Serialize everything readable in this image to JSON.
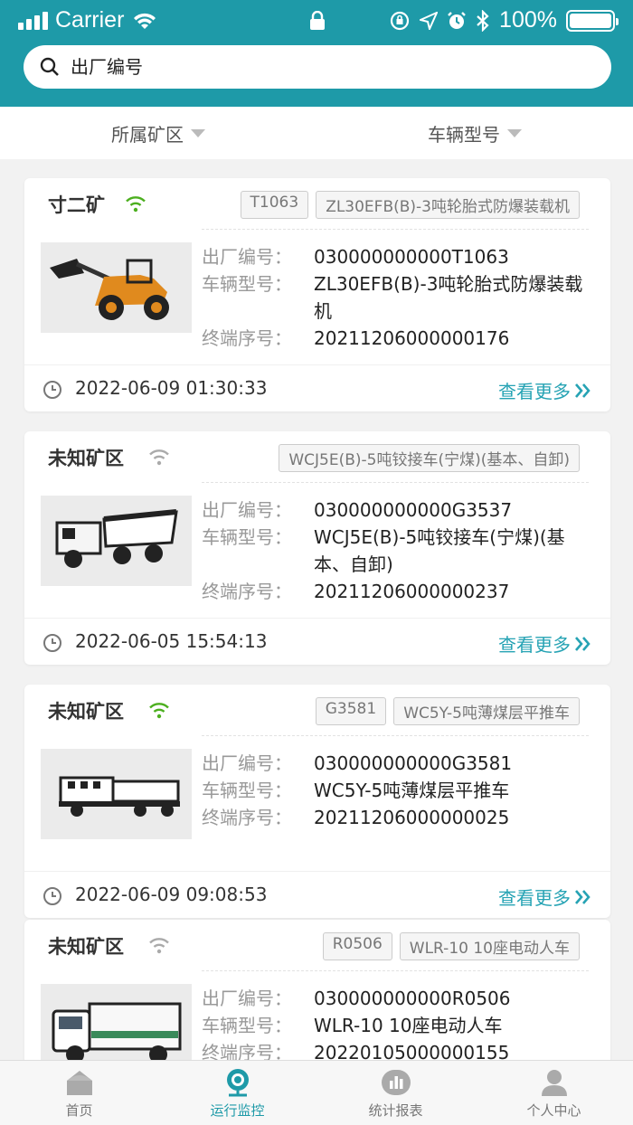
{
  "status_bar": {
    "carrier": "Carrier",
    "battery": "100%"
  },
  "search": {
    "placeholder": "出厂编号"
  },
  "filters": [
    {
      "label": "所属矿区"
    },
    {
      "label": "车辆型号"
    }
  ],
  "labels": {
    "factory_no": "出厂编号：",
    "model": "车辆型号：",
    "terminal": "终端序号：",
    "more": "查看更多"
  },
  "colors": {
    "primary": "#1e9aa8",
    "online": "#4caf1f",
    "offline": "#aaaaaa",
    "link": "#26a3b4"
  },
  "cards": [
    {
      "mine": "寸二矿",
      "online": true,
      "tags": [
        "T1063",
        "ZL30EFB(B)-3吨轮胎式防爆装载机"
      ],
      "factory_no": "030000000000T1063",
      "model": "ZL30EFB(B)-3吨轮胎式防爆装载机",
      "terminal": "20211206000000176",
      "time": "2022-06-09 01:30:33",
      "image": "wheel-loader"
    },
    {
      "mine": "未知矿区",
      "online": false,
      "tags": [
        "WCJ5E(B)-5吨铰接车(宁煤)(基本、自卸)"
      ],
      "factory_no": "030000000000G3537",
      "model": "WCJ5E(B)-5吨铰接车(宁煤)(基本、自卸)",
      "terminal": "20211206000000237",
      "time": "2022-06-05 15:54:13",
      "image": "dump-truck"
    },
    {
      "mine": "未知矿区",
      "online": true,
      "tags": [
        "G3581",
        "WC5Y-5吨薄煤层平推车"
      ],
      "factory_no": "030000000000G3581",
      "model": "WC5Y-5吨薄煤层平推车",
      "terminal": "20211206000000025",
      "time": "2022-06-09 09:08:53",
      "image": "flatbed-truck"
    },
    {
      "mine": "未知矿区",
      "online": false,
      "tags": [
        "R0506",
        "WLR-10 10座电动人车"
      ],
      "factory_no": "030000000000R0506",
      "model": "WLR-10 10座电动人车",
      "terminal": "20220105000000155",
      "time": "",
      "image": "personnel-truck"
    }
  ],
  "tabs": [
    {
      "label": "首页",
      "icon": "home-icon",
      "active": false
    },
    {
      "label": "运行监控",
      "icon": "monitor-icon",
      "active": true
    },
    {
      "label": "统计报表",
      "icon": "report-icon",
      "active": false
    },
    {
      "label": "个人中心",
      "icon": "user-icon",
      "active": false
    }
  ]
}
